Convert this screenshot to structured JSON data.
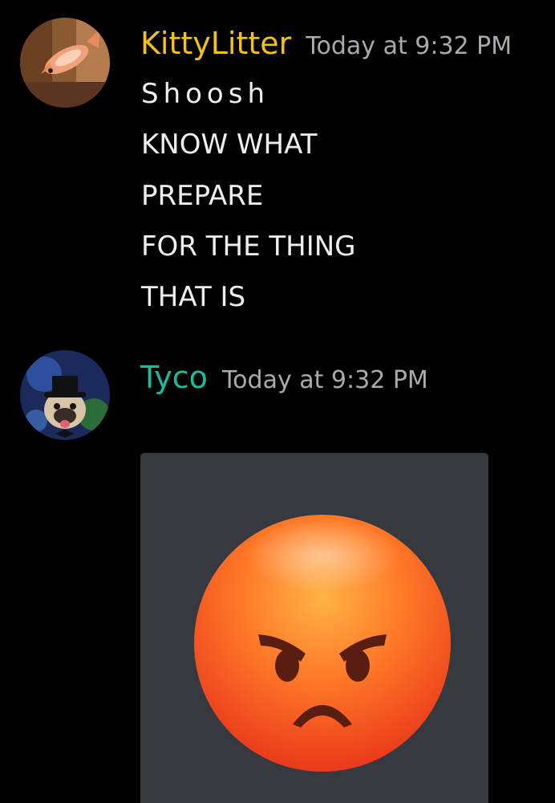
{
  "messages": [
    {
      "author": "KittyLitter",
      "timestamp": "Today at 9:32 PM",
      "author_color": "#f1c40f",
      "avatar_icon": "fish-avatar",
      "lines": [
        "Shoosh",
        "KNOW WHAT",
        "PREPARE",
        "FOR THE THING",
        "THAT IS"
      ]
    },
    {
      "author": "Tyco",
      "timestamp": "Today at 9:32 PM",
      "author_color": "#1abc9c",
      "avatar_icon": "pug-top-hat-avatar",
      "attachment": {
        "type": "image",
        "content": "angry-face-emoji"
      }
    }
  ],
  "colors": {
    "background": "#000000",
    "timestamp": "#a9aaad",
    "text": "#eeeeee",
    "embed_background": "#36393f"
  }
}
